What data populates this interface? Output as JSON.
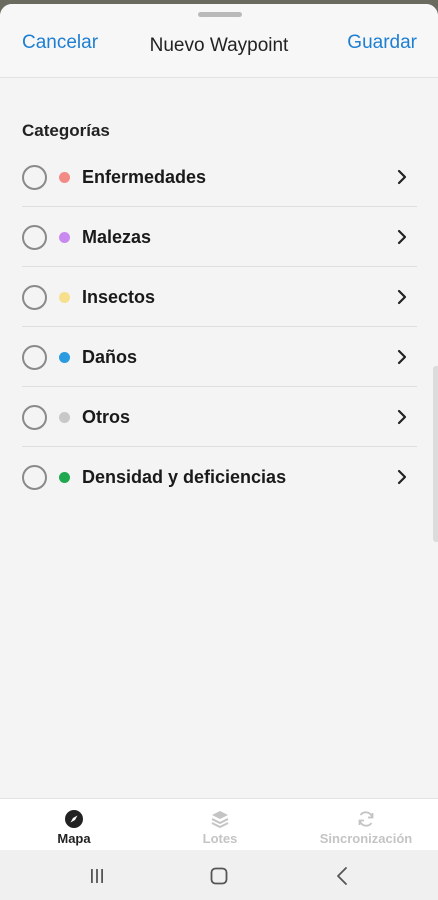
{
  "header": {
    "cancel_label": "Cancelar",
    "title": "Nuevo Waypoint",
    "save_label": "Guardar",
    "accent_color": "#1e7fd2"
  },
  "section": {
    "title": "Categorías"
  },
  "categories": [
    {
      "label": "Enfermedades",
      "color": "#f28b85",
      "selected": false
    },
    {
      "label": "Malezas",
      "color": "#c98af0",
      "selected": false
    },
    {
      "label": "Insectos",
      "color": "#f7df8e",
      "selected": false
    },
    {
      "label": "Daños",
      "color": "#2a9be0",
      "selected": false
    },
    {
      "label": "Otros",
      "color": "#c8c8c8",
      "selected": false
    },
    {
      "label": "Densidad y deficiencias",
      "color": "#1fa84f",
      "selected": false
    }
  ],
  "tabbar": {
    "tabs": [
      {
        "label": "Mapa",
        "icon": "compass-icon",
        "active": true
      },
      {
        "label": "Lotes",
        "icon": "layers-icon",
        "active": false
      },
      {
        "label": "Sincronización",
        "icon": "sync-icon",
        "active": false
      }
    ]
  },
  "navbar": {
    "buttons": [
      "recent-apps-icon",
      "home-icon",
      "back-icon"
    ]
  }
}
